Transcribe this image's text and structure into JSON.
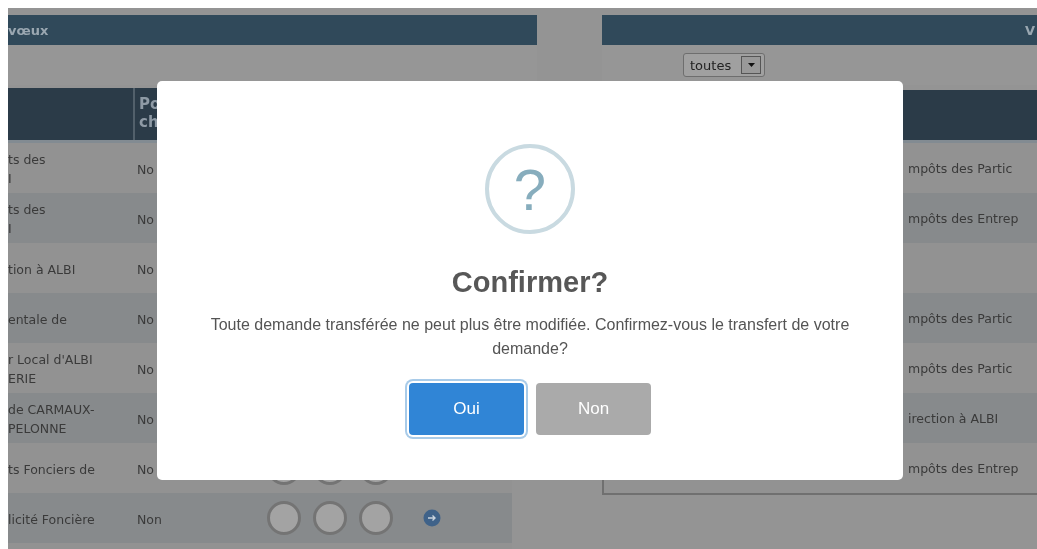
{
  "left_panel": {
    "title": "vœux",
    "header_column_2": [
      "Po",
      "ch"
    ],
    "rows": [
      {
        "column_1": [
          "ts des",
          "I"
        ],
        "column_2": "No"
      },
      {
        "column_1": [
          "ts des",
          "I"
        ],
        "column_2": "No"
      },
      {
        "column_1": [
          "tion à ALBI"
        ],
        "column_2": "No"
      },
      {
        "column_1": [
          "entale de"
        ],
        "column_2": "No"
      },
      {
        "column_1": [
          "r Local d'ALBI",
          "ERIE"
        ],
        "column_2": "No"
      },
      {
        "column_1": [
          "de CARMAUX-",
          "PELONNE"
        ],
        "column_2": "No"
      },
      {
        "column_1": [
          "ts Fonciers de"
        ],
        "column_2": "No"
      },
      {
        "column_1": [
          "licité Foncière"
        ],
        "column_2": "Non",
        "action_arrow": true
      }
    ]
  },
  "right_panel": {
    "title": "V",
    "filter": {
      "value": "toutes"
    },
    "rows": [
      {
        "text": "mpôts des Partic"
      },
      {
        "text": "mpôts des Entrep"
      },
      {},
      {
        "text": "mpôts des Partic"
      },
      {
        "text": "mpôts des Partic"
      },
      {
        "text": "irection à ALBI"
      },
      {
        "text": "mpôts des Entrep"
      }
    ]
  },
  "dialog": {
    "icon": "?",
    "title": "Confirmer?",
    "message": "Toute demande transférée ne peut plus être modifiée. Confirmez-vous le transfert de votre demande?",
    "buttons": [
      {
        "label": "Oui",
        "kind": "confirm",
        "focused": true
      },
      {
        "label": "Non",
        "kind": "cancel",
        "focused": false
      }
    ]
  }
}
